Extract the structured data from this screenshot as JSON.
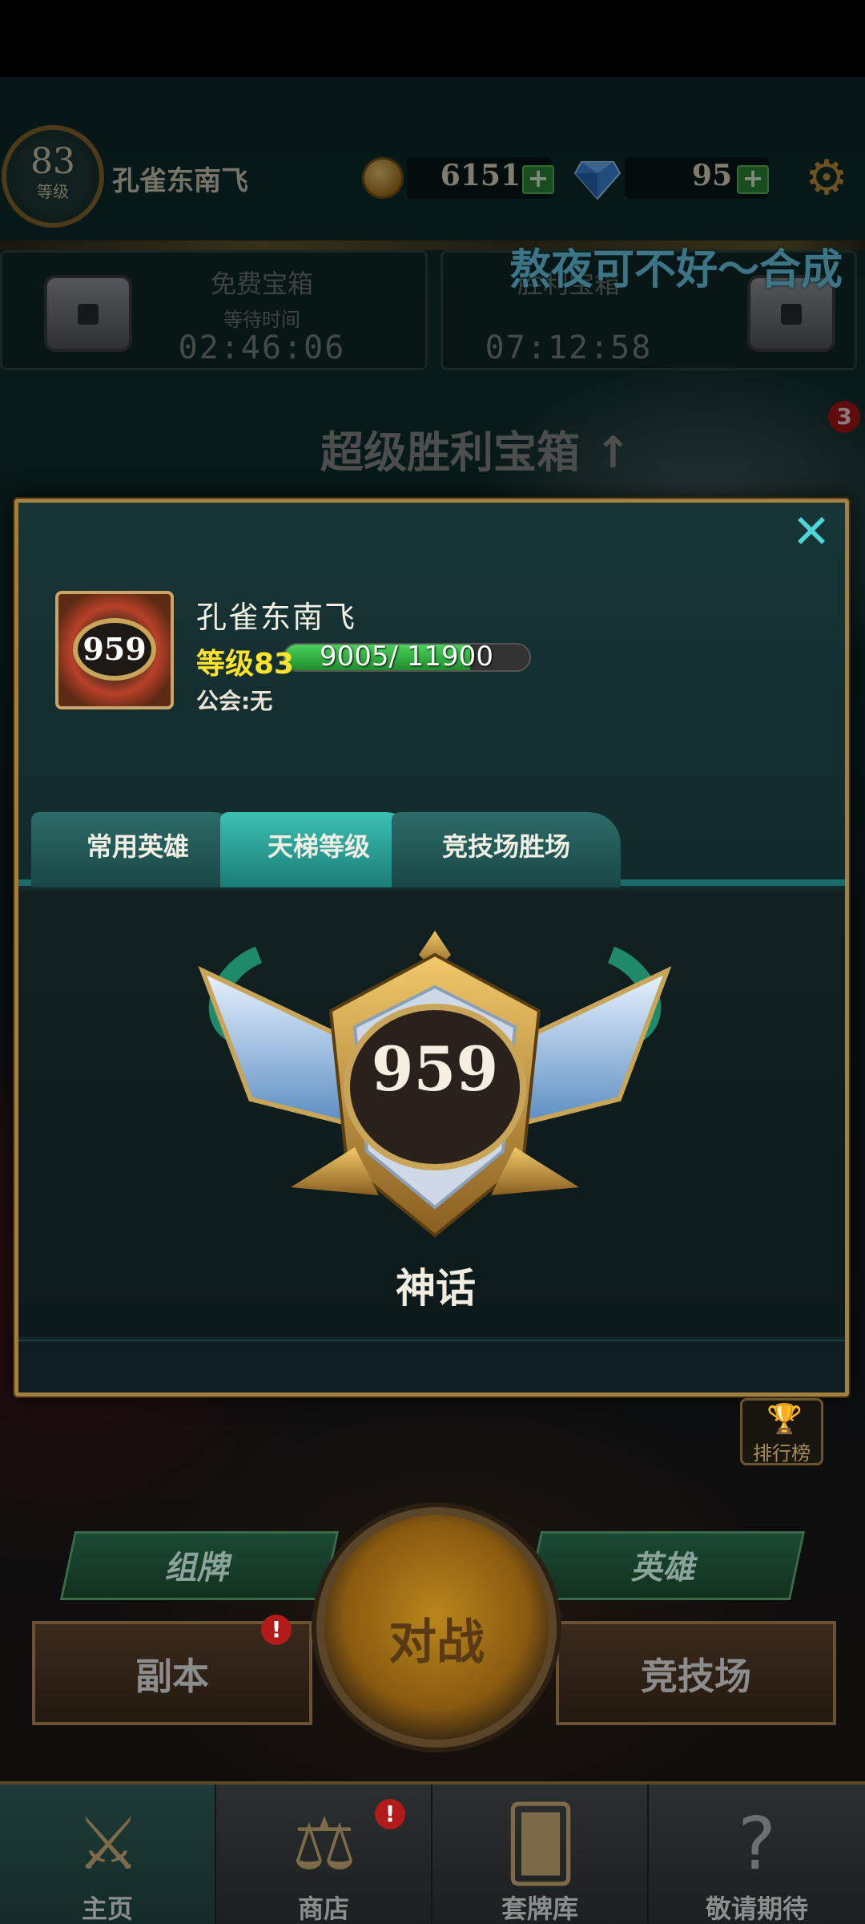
{
  "hud": {
    "level_number": "83",
    "level_label": "等级",
    "player_name": "孔雀东南飞",
    "coins": "6151",
    "gems": "95"
  },
  "chests": {
    "free": {
      "title": "免费宝箱",
      "subtitle": "等待时间",
      "timer": "02:46:06"
    },
    "victory": {
      "title": "胜利宝箱",
      "timer": "07:12:58"
    }
  },
  "overlay_text": "熬夜可不好～合成",
  "super_chest": {
    "label": "超级胜利宝箱 ↑",
    "badge": "3"
  },
  "profile": {
    "avatar_number": "959",
    "name": "孔雀东南飞",
    "level_text": "等级83",
    "xp_text": "9005/ 11900",
    "xp_current": 9005,
    "xp_max": 11900,
    "guild": "公会:无"
  },
  "tabs": [
    {
      "label": "常用英雄",
      "active": false
    },
    {
      "label": "天梯等级",
      "active": true
    },
    {
      "label": "竞技场胜场",
      "active": false
    }
  ],
  "rank": {
    "number": "959",
    "title": "神话"
  },
  "leaderboard_label": "排行榜",
  "actions": {
    "deck": "组牌",
    "heroes": "英雄",
    "dungeon": "副本",
    "battle": "对战",
    "arena": "竞技场",
    "alert_mark": "!"
  },
  "nav": [
    {
      "label": "主页"
    },
    {
      "label": "商店"
    },
    {
      "label": "套牌库"
    },
    {
      "label": "敬请期待"
    }
  ],
  "colors": {
    "accent_teal": "#3cc0b2",
    "gold": "#a3803e",
    "level_yellow": "#ffe32a",
    "overlay_blue": "#6fd4f5"
  }
}
